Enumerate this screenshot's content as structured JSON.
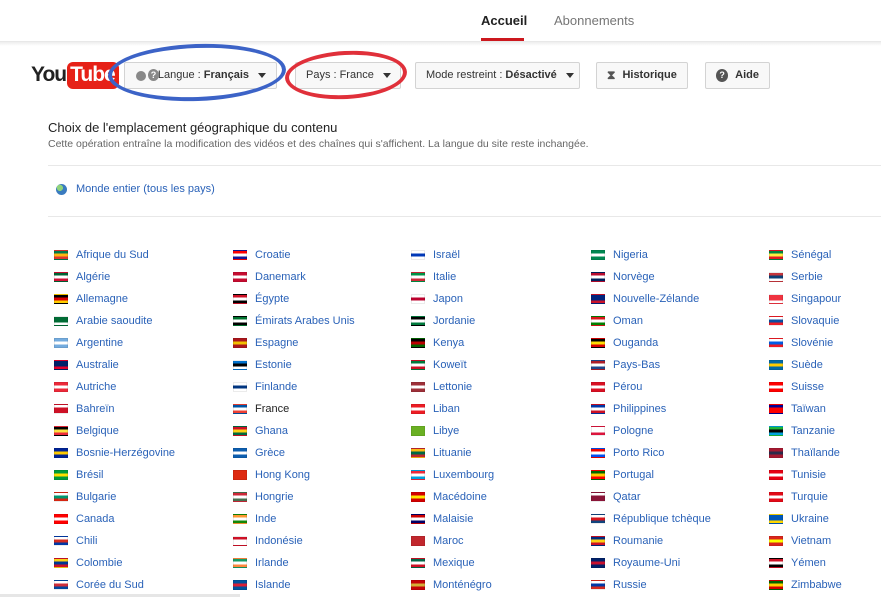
{
  "nav": {
    "home": "Accueil",
    "subscriptions": "Abonnements"
  },
  "logo": {
    "you": "You",
    "tube": "Tube"
  },
  "toolbar": {
    "lang_prefix": "Langue :",
    "lang_value": "Français",
    "country_prefix": "Pays :",
    "country_value": "France",
    "restrict_prefix": "Mode restreint :",
    "restrict_value": "Désactivé",
    "history": "Historique",
    "help": "Aide"
  },
  "section": {
    "title": "Choix de l'emplacement géographique du contenu",
    "subtitle": "Cette opération entraîne la modification des vidéos et des chaînes qui s'affichent. La langue du site reste inchangée.",
    "worldwide": "Monde entier (tous les pays)"
  },
  "columns": [
    [
      {
        "name": "Afrique du Sud",
        "colors": [
          "#007a4d",
          "#ffb612",
          "#de3831"
        ]
      },
      {
        "name": "Algérie",
        "colors": [
          "#006233",
          "#ffffff",
          "#d21034"
        ]
      },
      {
        "name": "Allemagne",
        "colors": [
          "#000000",
          "#dd0000",
          "#ffce00"
        ]
      },
      {
        "name": "Arabie saoudite",
        "colors": [
          "#006c35",
          "#006c35",
          "#ffffff"
        ]
      },
      {
        "name": "Argentine",
        "colors": [
          "#74acdf",
          "#ffffff",
          "#74acdf"
        ]
      },
      {
        "name": "Australie",
        "colors": [
          "#012169",
          "#012169",
          "#e4002b"
        ]
      },
      {
        "name": "Autriche",
        "colors": [
          "#ed2939",
          "#ffffff",
          "#ed2939"
        ]
      },
      {
        "name": "Bahreïn",
        "colors": [
          "#ffffff",
          "#ce1126",
          "#ce1126"
        ]
      },
      {
        "name": "Belgique",
        "colors": [
          "#000000",
          "#fae042",
          "#ed2939"
        ]
      },
      {
        "name": "Bosnie-Herzégovine",
        "colors": [
          "#002395",
          "#fecb00",
          "#002395"
        ]
      },
      {
        "name": "Brésil",
        "colors": [
          "#009c3b",
          "#ffdf00",
          "#009c3b"
        ]
      },
      {
        "name": "Bulgarie",
        "colors": [
          "#ffffff",
          "#00966e",
          "#d62612"
        ]
      },
      {
        "name": "Canada",
        "colors": [
          "#ff0000",
          "#ffffff",
          "#ff0000"
        ]
      },
      {
        "name": "Chili",
        "colors": [
          "#ffffff",
          "#d52b1e",
          "#0039a6"
        ]
      },
      {
        "name": "Colombie",
        "colors": [
          "#fcd116",
          "#003893",
          "#ce1126"
        ]
      },
      {
        "name": "Corée du Sud",
        "colors": [
          "#ffffff",
          "#cd2e3a",
          "#0047a0"
        ]
      }
    ],
    [
      {
        "name": "Croatie",
        "colors": [
          "#ff0000",
          "#ffffff",
          "#171796"
        ]
      },
      {
        "name": "Danemark",
        "colors": [
          "#c60c30",
          "#ffffff",
          "#c60c30"
        ]
      },
      {
        "name": "Égypte",
        "colors": [
          "#ce1126",
          "#ffffff",
          "#000000"
        ]
      },
      {
        "name": "Émirats Arabes Unis",
        "colors": [
          "#00732f",
          "#ffffff",
          "#000000"
        ]
      },
      {
        "name": "Espagne",
        "colors": [
          "#aa151b",
          "#f1bf00",
          "#aa151b"
        ]
      },
      {
        "name": "Estonie",
        "colors": [
          "#0072ce",
          "#000000",
          "#ffffff"
        ]
      },
      {
        "name": "Finlande",
        "colors": [
          "#ffffff",
          "#003580",
          "#ffffff"
        ]
      },
      {
        "name": "France",
        "colors": [
          "#0055a4",
          "#ffffff",
          "#ef4135"
        ]
      },
      {
        "name": "Ghana",
        "colors": [
          "#ce1126",
          "#fcd116",
          "#006b3f"
        ]
      },
      {
        "name": "Grèce",
        "colors": [
          "#0d5eaf",
          "#ffffff",
          "#0d5eaf"
        ]
      },
      {
        "name": "Hong Kong",
        "colors": [
          "#de2910",
          "#de2910",
          "#de2910"
        ]
      },
      {
        "name": "Hongrie",
        "colors": [
          "#ce2939",
          "#ffffff",
          "#477050"
        ]
      },
      {
        "name": "Inde",
        "colors": [
          "#ff9933",
          "#ffffff",
          "#138808"
        ]
      },
      {
        "name": "Indonésie",
        "colors": [
          "#ce1126",
          "#ffffff",
          "#ffffff"
        ]
      },
      {
        "name": "Irlande",
        "colors": [
          "#169b62",
          "#ffffff",
          "#ff883e"
        ]
      },
      {
        "name": "Islande",
        "colors": [
          "#02529c",
          "#dc1e35",
          "#02529c"
        ]
      }
    ],
    [
      {
        "name": "Israël",
        "colors": [
          "#ffffff",
          "#0038b8",
          "#ffffff"
        ]
      },
      {
        "name": "Italie",
        "colors": [
          "#009246",
          "#ffffff",
          "#ce2b37"
        ]
      },
      {
        "name": "Japon",
        "colors": [
          "#ffffff",
          "#bc002d",
          "#ffffff"
        ]
      },
      {
        "name": "Jordanie",
        "colors": [
          "#000000",
          "#ffffff",
          "#007a3d"
        ]
      },
      {
        "name": "Kenya",
        "colors": [
          "#000000",
          "#bb0000",
          "#006600"
        ]
      },
      {
        "name": "Koweït",
        "colors": [
          "#007a3d",
          "#ffffff",
          "#ce1126"
        ]
      },
      {
        "name": "Lettonie",
        "colors": [
          "#9e3039",
          "#ffffff",
          "#9e3039"
        ]
      },
      {
        "name": "Liban",
        "colors": [
          "#ed1c24",
          "#ffffff",
          "#ed1c24"
        ]
      },
      {
        "name": "Libye",
        "colors": [
          "#6ab023",
          "#6ab023",
          "#6ab023"
        ]
      },
      {
        "name": "Lituanie",
        "colors": [
          "#fdb913",
          "#006a44",
          "#c1272d"
        ]
      },
      {
        "name": "Luxembourg",
        "colors": [
          "#ed2939",
          "#ffffff",
          "#00a1de"
        ]
      },
      {
        "name": "Macédoine",
        "colors": [
          "#d20000",
          "#ffe600",
          "#d20000"
        ]
      },
      {
        "name": "Malaisie",
        "colors": [
          "#cc0001",
          "#ffffff",
          "#010066"
        ]
      },
      {
        "name": "Maroc",
        "colors": [
          "#c1272d",
          "#c1272d",
          "#c1272d"
        ]
      },
      {
        "name": "Mexique",
        "colors": [
          "#006847",
          "#ffffff",
          "#ce1126"
        ]
      },
      {
        "name": "Monténégro",
        "colors": [
          "#c40308",
          "#d4af37",
          "#c40308"
        ]
      }
    ],
    [
      {
        "name": "Nigeria",
        "colors": [
          "#008751",
          "#ffffff",
          "#008751"
        ]
      },
      {
        "name": "Norvège",
        "colors": [
          "#ba0c2f",
          "#ffffff",
          "#00205b"
        ]
      },
      {
        "name": "Nouvelle-Zélande",
        "colors": [
          "#00247d",
          "#00247d",
          "#cc142b"
        ]
      },
      {
        "name": "Oman",
        "colors": [
          "#db161b",
          "#ffffff",
          "#008000"
        ]
      },
      {
        "name": "Ouganda",
        "colors": [
          "#000000",
          "#fcdc04",
          "#d90000"
        ]
      },
      {
        "name": "Pays-Bas",
        "colors": [
          "#ae1c28",
          "#ffffff",
          "#21468b"
        ]
      },
      {
        "name": "Pérou",
        "colors": [
          "#d91023",
          "#ffffff",
          "#d91023"
        ]
      },
      {
        "name": "Philippines",
        "colors": [
          "#0038a8",
          "#ffffff",
          "#ce1126"
        ]
      },
      {
        "name": "Pologne",
        "colors": [
          "#ffffff",
          "#ffffff",
          "#dc143c"
        ]
      },
      {
        "name": "Porto Rico",
        "colors": [
          "#ed0000",
          "#ffffff",
          "#0050f0"
        ]
      },
      {
        "name": "Portugal",
        "colors": [
          "#006600",
          "#ffcc00",
          "#ff0000"
        ]
      },
      {
        "name": "Qatar",
        "colors": [
          "#ffffff",
          "#8a1538",
          "#8a1538"
        ]
      },
      {
        "name": "République tchèque",
        "colors": [
          "#ffffff",
          "#d7141a",
          "#11457e"
        ]
      },
      {
        "name": "Roumanie",
        "colors": [
          "#002b7f",
          "#fcd116",
          "#ce1126"
        ]
      },
      {
        "name": "Royaume-Uni",
        "colors": [
          "#012169",
          "#c8102e",
          "#012169"
        ]
      },
      {
        "name": "Russie",
        "colors": [
          "#ffffff",
          "#0039a6",
          "#d52b1e"
        ]
      }
    ],
    [
      {
        "name": "Sénégal",
        "colors": [
          "#00853f",
          "#fdef42",
          "#e31b23"
        ]
      },
      {
        "name": "Serbie",
        "colors": [
          "#c6363c",
          "#0c4076",
          "#ffffff"
        ]
      },
      {
        "name": "Singapour",
        "colors": [
          "#ef3340",
          "#ef3340",
          "#ffffff"
        ]
      },
      {
        "name": "Slovaquie",
        "colors": [
          "#ffffff",
          "#0b4ea2",
          "#ee1c25"
        ]
      },
      {
        "name": "Slovénie",
        "colors": [
          "#ffffff",
          "#005ce5",
          "#ed1c24"
        ]
      },
      {
        "name": "Suède",
        "colors": [
          "#006aa7",
          "#fecc00",
          "#006aa7"
        ]
      },
      {
        "name": "Suisse",
        "colors": [
          "#ff0000",
          "#ffffff",
          "#ff0000"
        ]
      },
      {
        "name": "Taïwan",
        "colors": [
          "#000095",
          "#fe0000",
          "#fe0000"
        ]
      },
      {
        "name": "Tanzanie",
        "colors": [
          "#1eb53a",
          "#000000",
          "#00a3dd"
        ]
      },
      {
        "name": "Thaïlande",
        "colors": [
          "#a51931",
          "#2d2a4a",
          "#a51931"
        ]
      },
      {
        "name": "Tunisie",
        "colors": [
          "#e70013",
          "#ffffff",
          "#e70013"
        ]
      },
      {
        "name": "Turquie",
        "colors": [
          "#e30a17",
          "#ffffff",
          "#e30a17"
        ]
      },
      {
        "name": "Ukraine",
        "colors": [
          "#0057b7",
          "#0057b7",
          "#ffd700"
        ]
      },
      {
        "name": "Vietnam",
        "colors": [
          "#da251d",
          "#ffff00",
          "#da251d"
        ]
      },
      {
        "name": "Yémen",
        "colors": [
          "#ce1126",
          "#ffffff",
          "#000000"
        ]
      },
      {
        "name": "Zimbabwe",
        "colors": [
          "#006400",
          "#ffd200",
          "#d40000"
        ]
      }
    ]
  ],
  "selected_country": "France",
  "colors": {
    "link": "#2a62b8",
    "accent": "#cc181e",
    "annotation_blue": "#3c63c7",
    "annotation_red": "#e0303a"
  }
}
